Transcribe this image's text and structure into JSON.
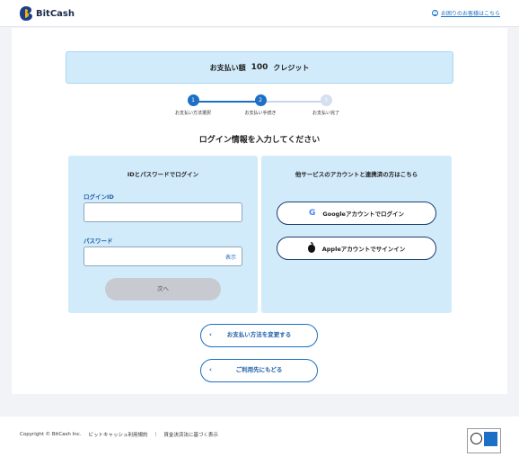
{
  "header": {
    "logo_text": "BitCash",
    "help_link": "お困りのお客様はこちら"
  },
  "payment": {
    "label": "お支払い額",
    "amount": "100",
    "unit": "クレジット"
  },
  "steps": [
    {
      "num": "1",
      "label": "お支払い方法選択"
    },
    {
      "num": "2",
      "label": "お支払い手続き"
    },
    {
      "num": "3",
      "label": "お支払い完了"
    }
  ],
  "title": "ログイン情報を入力してください",
  "login_panel": {
    "title": "IDとパスワードでログイン",
    "id_label": "ログインID",
    "password_label": "パスワード",
    "show_label": "表示",
    "next_label": "次へ"
  },
  "social_panel": {
    "title": "他サービスのアカウントと連携済の方はこちら",
    "google_label": "Googleアカウントでログイン",
    "apple_label": "Appleアカウントでサインイン"
  },
  "actions": {
    "change_method": "お支払い方法を変更する",
    "back_to_merchant": "ご利用先にもどる"
  },
  "footer": {
    "copyright": "Copyright © BitCash Inc.",
    "terms": "ビットキャッシュ利用規約",
    "legal": "資金決済法に基づく表示"
  },
  "colors": {
    "accent": "#1c6fc4",
    "panel_bg": "#d2ebfb",
    "disabled_button": "#c7cbd1"
  }
}
